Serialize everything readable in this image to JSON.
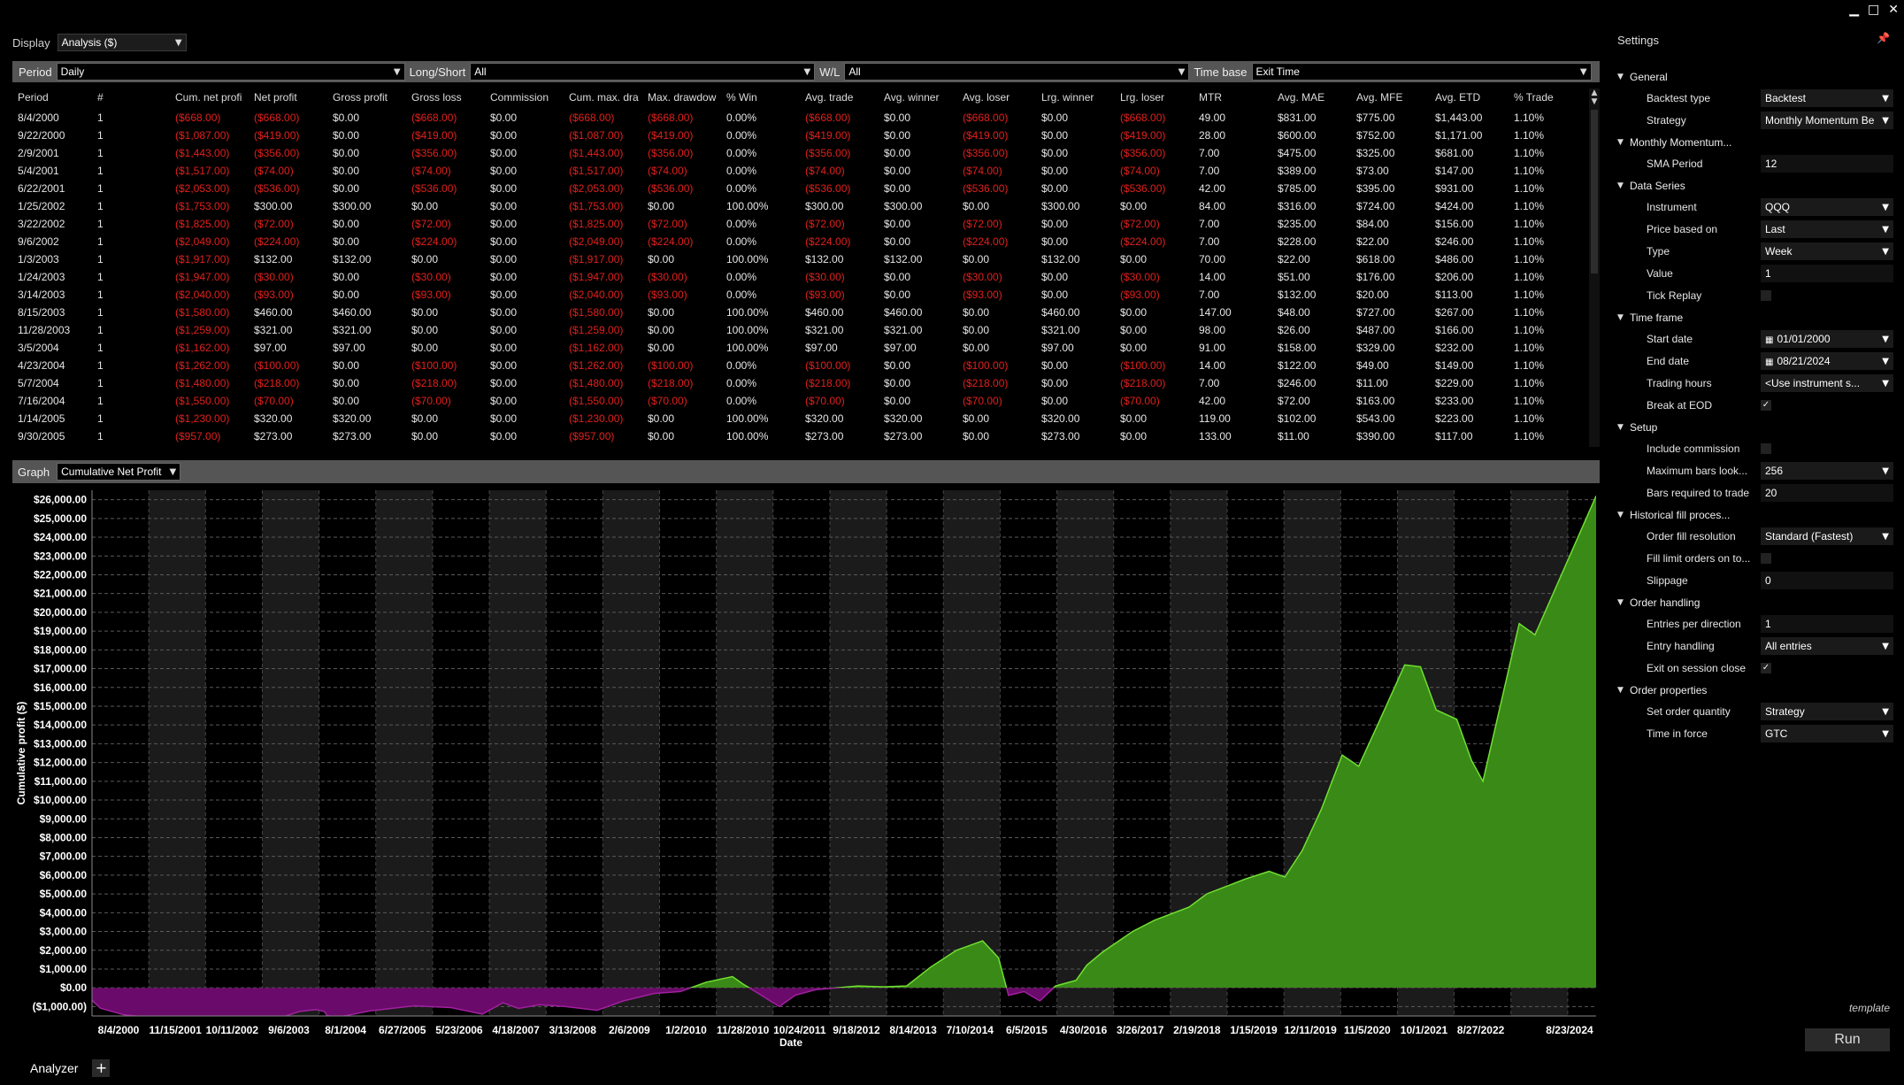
{
  "window_controls": {
    "minimize": "▁",
    "maximize": "□",
    "close": "✕"
  },
  "display": {
    "label": "Display",
    "value": "Analysis ($)"
  },
  "filters": [
    {
      "label": "Period",
      "value": "Daily"
    },
    {
      "label": "Long/Short",
      "value": "All"
    },
    {
      "label": "W/L",
      "value": "All"
    },
    {
      "label": "Time base",
      "value": "Exit Time"
    }
  ],
  "table": {
    "columns": [
      "Period",
      "#",
      "Cum. net profi",
      "Net profit",
      "Gross profit",
      "Gross loss",
      "Commission",
      "Cum. max. dra",
      "Max. drawdow",
      "% Win",
      "Avg. trade",
      "Avg. winner",
      "Avg. loser",
      "Lrg. winner",
      "Lrg. loser",
      "MTR",
      "Avg. MAE",
      "Avg. MFE",
      "Avg. ETD",
      "% Trade"
    ],
    "rows": [
      [
        "8/4/2000",
        "1",
        "($668.00)",
        "($668.00)",
        "$0.00",
        "($668.00)",
        "$0.00",
        "($668.00)",
        "($668.00)",
        "0.00%",
        "($668.00)",
        "$0.00",
        "($668.00)",
        "$0.00",
        "($668.00)",
        "49.00",
        "$831.00",
        "$775.00",
        "$1,443.00",
        "1.10%"
      ],
      [
        "9/22/2000",
        "1",
        "($1,087.00)",
        "($419.00)",
        "$0.00",
        "($419.00)",
        "$0.00",
        "($1,087.00)",
        "($419.00)",
        "0.00%",
        "($419.00)",
        "$0.00",
        "($419.00)",
        "$0.00",
        "($419.00)",
        "28.00",
        "$600.00",
        "$752.00",
        "$1,171.00",
        "1.10%"
      ],
      [
        "2/9/2001",
        "1",
        "($1,443.00)",
        "($356.00)",
        "$0.00",
        "($356.00)",
        "$0.00",
        "($1,443.00)",
        "($356.00)",
        "0.00%",
        "($356.00)",
        "$0.00",
        "($356.00)",
        "$0.00",
        "($356.00)",
        "7.00",
        "$475.00",
        "$325.00",
        "$681.00",
        "1.10%"
      ],
      [
        "5/4/2001",
        "1",
        "($1,517.00)",
        "($74.00)",
        "$0.00",
        "($74.00)",
        "$0.00",
        "($1,517.00)",
        "($74.00)",
        "0.00%",
        "($74.00)",
        "$0.00",
        "($74.00)",
        "$0.00",
        "($74.00)",
        "7.00",
        "$389.00",
        "$73.00",
        "$147.00",
        "1.10%"
      ],
      [
        "6/22/2001",
        "1",
        "($2,053.00)",
        "($536.00)",
        "$0.00",
        "($536.00)",
        "$0.00",
        "($2,053.00)",
        "($536.00)",
        "0.00%",
        "($536.00)",
        "$0.00",
        "($536.00)",
        "$0.00",
        "($536.00)",
        "42.00",
        "$785.00",
        "$395.00",
        "$931.00",
        "1.10%"
      ],
      [
        "1/25/2002",
        "1",
        "($1,753.00)",
        "$300.00",
        "$300.00",
        "$0.00",
        "$0.00",
        "($1,753.00)",
        "$0.00",
        "100.00%",
        "$300.00",
        "$300.00",
        "$0.00",
        "$300.00",
        "$0.00",
        "84.00",
        "$316.00",
        "$724.00",
        "$424.00",
        "1.10%"
      ],
      [
        "3/22/2002",
        "1",
        "($1,825.00)",
        "($72.00)",
        "$0.00",
        "($72.00)",
        "$0.00",
        "($1,825.00)",
        "($72.00)",
        "0.00%",
        "($72.00)",
        "$0.00",
        "($72.00)",
        "$0.00",
        "($72.00)",
        "7.00",
        "$235.00",
        "$84.00",
        "$156.00",
        "1.10%"
      ],
      [
        "9/6/2002",
        "1",
        "($2,049.00)",
        "($224.00)",
        "$0.00",
        "($224.00)",
        "$0.00",
        "($2,049.00)",
        "($224.00)",
        "0.00%",
        "($224.00)",
        "$0.00",
        "($224.00)",
        "$0.00",
        "($224.00)",
        "7.00",
        "$228.00",
        "$22.00",
        "$246.00",
        "1.10%"
      ],
      [
        "1/3/2003",
        "1",
        "($1,917.00)",
        "$132.00",
        "$132.00",
        "$0.00",
        "$0.00",
        "($1,917.00)",
        "$0.00",
        "100.00%",
        "$132.00",
        "$132.00",
        "$0.00",
        "$132.00",
        "$0.00",
        "70.00",
        "$22.00",
        "$618.00",
        "$486.00",
        "1.10%"
      ],
      [
        "1/24/2003",
        "1",
        "($1,947.00)",
        "($30.00)",
        "$0.00",
        "($30.00)",
        "$0.00",
        "($1,947.00)",
        "($30.00)",
        "0.00%",
        "($30.00)",
        "$0.00",
        "($30.00)",
        "$0.00",
        "($30.00)",
        "14.00",
        "$51.00",
        "$176.00",
        "$206.00",
        "1.10%"
      ],
      [
        "3/14/2003",
        "1",
        "($2,040.00)",
        "($93.00)",
        "$0.00",
        "($93.00)",
        "$0.00",
        "($2,040.00)",
        "($93.00)",
        "0.00%",
        "($93.00)",
        "$0.00",
        "($93.00)",
        "$0.00",
        "($93.00)",
        "7.00",
        "$132.00",
        "$20.00",
        "$113.00",
        "1.10%"
      ],
      [
        "8/15/2003",
        "1",
        "($1,580.00)",
        "$460.00",
        "$460.00",
        "$0.00",
        "$0.00",
        "($1,580.00)",
        "$0.00",
        "100.00%",
        "$460.00",
        "$460.00",
        "$0.00",
        "$460.00",
        "$0.00",
        "147.00",
        "$48.00",
        "$727.00",
        "$267.00",
        "1.10%"
      ],
      [
        "11/28/2003",
        "1",
        "($1,259.00)",
        "$321.00",
        "$321.00",
        "$0.00",
        "$0.00",
        "($1,259.00)",
        "$0.00",
        "100.00%",
        "$321.00",
        "$321.00",
        "$0.00",
        "$321.00",
        "$0.00",
        "98.00",
        "$26.00",
        "$487.00",
        "$166.00",
        "1.10%"
      ],
      [
        "3/5/2004",
        "1",
        "($1,162.00)",
        "$97.00",
        "$97.00",
        "$0.00",
        "$0.00",
        "($1,162.00)",
        "$0.00",
        "100.00%",
        "$97.00",
        "$97.00",
        "$0.00",
        "$97.00",
        "$0.00",
        "91.00",
        "$158.00",
        "$329.00",
        "$232.00",
        "1.10%"
      ],
      [
        "4/23/2004",
        "1",
        "($1,262.00)",
        "($100.00)",
        "$0.00",
        "($100.00)",
        "$0.00",
        "($1,262.00)",
        "($100.00)",
        "0.00%",
        "($100.00)",
        "$0.00",
        "($100.00)",
        "$0.00",
        "($100.00)",
        "14.00",
        "$122.00",
        "$49.00",
        "$149.00",
        "1.10%"
      ],
      [
        "5/7/2004",
        "1",
        "($1,480.00)",
        "($218.00)",
        "$0.00",
        "($218.00)",
        "$0.00",
        "($1,480.00)",
        "($218.00)",
        "0.00%",
        "($218.00)",
        "$0.00",
        "($218.00)",
        "$0.00",
        "($218.00)",
        "7.00",
        "$246.00",
        "$11.00",
        "$229.00",
        "1.10%"
      ],
      [
        "7/16/2004",
        "1",
        "($1,550.00)",
        "($70.00)",
        "$0.00",
        "($70.00)",
        "$0.00",
        "($1,550.00)",
        "($70.00)",
        "0.00%",
        "($70.00)",
        "$0.00",
        "($70.00)",
        "$0.00",
        "($70.00)",
        "42.00",
        "$72.00",
        "$163.00",
        "$233.00",
        "1.10%"
      ],
      [
        "1/14/2005",
        "1",
        "($1,230.00)",
        "$320.00",
        "$320.00",
        "$0.00",
        "$0.00",
        "($1,230.00)",
        "$0.00",
        "100.00%",
        "$320.00",
        "$320.00",
        "$0.00",
        "$320.00",
        "$0.00",
        "119.00",
        "$102.00",
        "$543.00",
        "$223.00",
        "1.10%"
      ],
      [
        "9/30/2005",
        "1",
        "($957.00)",
        "$273.00",
        "$273.00",
        "$0.00",
        "$0.00",
        "($957.00)",
        "$0.00",
        "100.00%",
        "$273.00",
        "$273.00",
        "$0.00",
        "$273.00",
        "$0.00",
        "133.00",
        "$11.00",
        "$390.00",
        "$117.00",
        "1.10%"
      ]
    ]
  },
  "graph": {
    "label": "Graph",
    "value": "Cumulative Net Profit"
  },
  "chart_data": {
    "type": "area",
    "xlabel": "Date",
    "ylabel": "Cumulative profit ($)",
    "ylim": [
      -1500,
      26500
    ],
    "yticks": [
      26000,
      25000,
      24000,
      23000,
      22000,
      21000,
      20000,
      19000,
      18000,
      17000,
      16000,
      15000,
      14000,
      13000,
      12000,
      11000,
      10000,
      9000,
      8000,
      7000,
      6000,
      5000,
      4000,
      3000,
      2000,
      1000,
      0,
      -1000
    ],
    "ytick_labels": [
      "$26,000.00",
      "$25,000.00",
      "$24,000.00",
      "$23,000.00",
      "$22,000.00",
      "$21,000.00",
      "$20,000.00",
      "$19,000.00",
      "$18,000.00",
      "$17,000.00",
      "$16,000.00",
      "$15,000.00",
      "$14,000.00",
      "$13,000.00",
      "$12,000.00",
      "$11,000.00",
      "$10,000.00",
      "$9,000.00",
      "$8,000.00",
      "$7,000.00",
      "$6,000.00",
      "$5,000.00",
      "$4,000.00",
      "$3,000.00",
      "$2,000.00",
      "$1,000.00",
      "$0.00",
      "($1,000.00)"
    ],
    "xtick_labels": [
      "8/4/2000",
      "11/15/2001",
      "10/11/2002",
      "9/6/2003",
      "8/1/2004",
      "6/27/2005",
      "5/23/2006",
      "4/18/2007",
      "3/13/2008",
      "2/6/2009",
      "1/2/2010",
      "11/28/2010",
      "10/24/2011",
      "9/18/2012",
      "8/14/2013",
      "7/10/2014",
      "6/5/2015",
      "4/30/2016",
      "3/26/2017",
      "2/19/2018",
      "1/15/2019",
      "12/11/2019",
      "11/5/2020",
      "10/1/2021",
      "8/27/2022",
      "8/23/2024"
    ],
    "x_range": [
      "2000-08-04",
      "2024-08-23"
    ],
    "series": [
      {
        "x": [
          "2000-08-04",
          "2000-09-22",
          "2001-02-09",
          "2001-05-04",
          "2001-06-22",
          "2002-01-25",
          "2002-03-22",
          "2002-09-06",
          "2003-01-03",
          "2003-01-24",
          "2003-03-14",
          "2003-08-15",
          "2003-11-28",
          "2004-03-05",
          "2004-04-23",
          "2004-05-07",
          "2004-07-16",
          "2005-01-14",
          "2005-09-30",
          "2006-05-01",
          "2006-11-01",
          "2007-03-01",
          "2007-06-01",
          "2007-10-01",
          "2008-03-01",
          "2008-09-01",
          "2009-02-01",
          "2009-08-01",
          "2010-01-01",
          "2010-06-01",
          "2010-11-01",
          "2011-01-01",
          "2011-04-01",
          "2011-08-01",
          "2011-11-01",
          "2012-03-01",
          "2012-07-01",
          "2012-11-01",
          "2013-04-01",
          "2013-08-14",
          "2014-01-01",
          "2014-06-01",
          "2014-11-01",
          "2015-02-01",
          "2015-04-01",
          "2015-07-01",
          "2015-10-01",
          "2016-01-01",
          "2016-04-30",
          "2016-07-01",
          "2016-10-01",
          "2017-03-26",
          "2017-08-01",
          "2018-02-19",
          "2018-06-01",
          "2019-01-15",
          "2019-06-01",
          "2019-09-01",
          "2019-12-11",
          "2020-04-01",
          "2020-08-01",
          "2020-11-05",
          "2021-03-01",
          "2021-08-01",
          "2021-11-01",
          "2022-02-01",
          "2022-06-01",
          "2022-08-27",
          "2022-11-01",
          "2023-06-01",
          "2023-09-01",
          "2024-08-23"
        ],
        "values": [
          -668,
          -1087,
          -1443,
          -1517,
          -2053,
          -1753,
          -1825,
          -2049,
          -1917,
          -1947,
          -2040,
          -1580,
          -1259,
          -1162,
          -1262,
          -1480,
          -1550,
          -1230,
          -957,
          -1050,
          -1400,
          -800,
          -1100,
          -900,
          -1000,
          -1200,
          -700,
          -300,
          -200,
          300,
          600,
          200,
          -300,
          -1000,
          -400,
          -100,
          0,
          100,
          50,
          100,
          1100,
          2000,
          2500,
          1600,
          -400,
          -200,
          -700,
          100,
          400,
          1200,
          1900,
          3000,
          3600,
          4300,
          5000,
          5800,
          6200,
          5900,
          7300,
          9500,
          12400,
          11800,
          14100,
          17200,
          17100,
          14800,
          14300,
          12100,
          11000,
          19400,
          18800,
          26200
        ]
      }
    ]
  },
  "settings": {
    "title": "Settings",
    "pin_icon": "pin-icon",
    "items": [
      {
        "kind": "cat",
        "label": "General"
      },
      {
        "kind": "select",
        "name": "Backtest type",
        "value": "Backtest"
      },
      {
        "kind": "select",
        "name": "Strategy",
        "value": "Monthly Momentum Be"
      },
      {
        "kind": "cat",
        "label": "Monthly Momentum..."
      },
      {
        "kind": "text",
        "name": "SMA Period",
        "value": "12"
      },
      {
        "kind": "cat",
        "label": "Data Series"
      },
      {
        "kind": "select",
        "name": "Instrument",
        "value": "QQQ"
      },
      {
        "kind": "select",
        "name": "Price based on",
        "value": "Last"
      },
      {
        "kind": "select",
        "name": "Type",
        "value": "Week"
      },
      {
        "kind": "text",
        "name": "Value",
        "value": "1"
      },
      {
        "kind": "check",
        "name": "Tick Replay",
        "value": ""
      },
      {
        "kind": "cat",
        "label": "Time frame"
      },
      {
        "kind": "date",
        "name": "Start date",
        "value": "01/01/2000"
      },
      {
        "kind": "date",
        "name": "End date",
        "value": "08/21/2024"
      },
      {
        "kind": "select",
        "name": "Trading hours",
        "value": "<Use instrument s..."
      },
      {
        "kind": "check",
        "name": "Break at EOD",
        "value": "✓"
      },
      {
        "kind": "cat",
        "label": "Setup"
      },
      {
        "kind": "check",
        "name": "Include commission",
        "value": ""
      },
      {
        "kind": "select",
        "name": "Maximum bars look...",
        "value": "256"
      },
      {
        "kind": "text",
        "name": "Bars required to trade",
        "value": "20"
      },
      {
        "kind": "cat",
        "label": "Historical fill proces..."
      },
      {
        "kind": "select",
        "name": "Order fill resolution",
        "value": "Standard (Fastest)"
      },
      {
        "kind": "check",
        "name": "Fill limit orders on to...",
        "value": ""
      },
      {
        "kind": "text",
        "name": "Slippage",
        "value": "0"
      },
      {
        "kind": "cat",
        "label": "Order handling"
      },
      {
        "kind": "text",
        "name": "Entries per direction",
        "value": "1"
      },
      {
        "kind": "select",
        "name": "Entry handling",
        "value": "All entries"
      },
      {
        "kind": "check",
        "name": "Exit on session close",
        "value": "✓"
      },
      {
        "kind": "cat",
        "label": "Order properties"
      },
      {
        "kind": "select",
        "name": "Set order quantity",
        "value": "Strategy"
      },
      {
        "kind": "select",
        "name": "Time in force",
        "value": "GTC"
      }
    ],
    "template_label": "template",
    "run_label": "Run"
  },
  "bottom": {
    "tab_label": "Analyzer",
    "add_label": "+"
  },
  "colors": {
    "positive": "#3a8a18",
    "positive_line": "#6fe030",
    "negative": "#6a0a6a",
    "negative_line": "#a020a0",
    "loss_text": "#e0201c",
    "toolbar": "#555555"
  }
}
